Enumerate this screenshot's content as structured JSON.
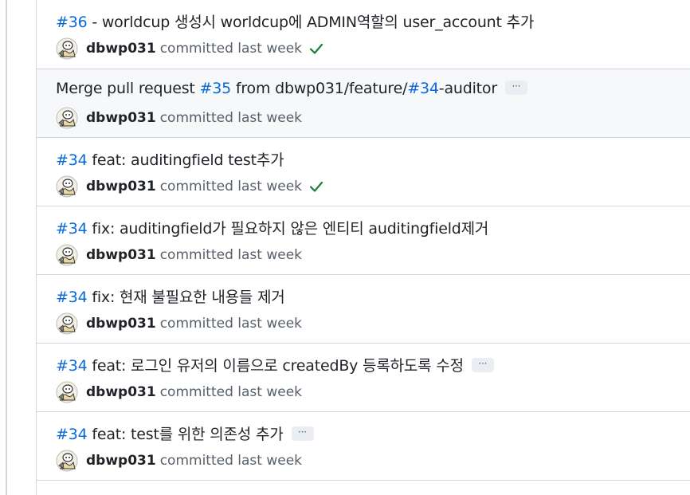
{
  "commits": [
    {
      "ref": "#36",
      "title": " - worldcup 생성시 worldcup에 ADMIN역할의 user_account 추가",
      "author": "dbwp031",
      "time": "committed last week",
      "verified": true,
      "more": false
    },
    {
      "prefix": "Merge pull request ",
      "ref": "#35",
      "middle": " from dbwp031/feature/",
      "ref2": "#34",
      "suffix": "-auditor",
      "author": "dbwp031",
      "time": "committed last week",
      "verified": false,
      "more": true
    },
    {
      "ref": "#34",
      "title": " feat: auditingfield test추가",
      "author": "dbwp031",
      "time": "committed last week",
      "verified": true,
      "more": false
    },
    {
      "ref": "#34",
      "title": " fix: auditingfield가 필요하지 않은 엔티티 auditingfield제거",
      "author": "dbwp031",
      "time": "committed last week",
      "verified": false,
      "more": false
    },
    {
      "ref": "#34",
      "title": " fix: 현재 불필요한 내용들 제거",
      "author": "dbwp031",
      "time": "committed last week",
      "verified": false,
      "more": false
    },
    {
      "ref": "#34",
      "title": " feat: 로그인 유저의 이름으로 createdBy 등록하도록 수정",
      "author": "dbwp031",
      "time": "committed last week",
      "verified": false,
      "more": true
    },
    {
      "ref": "#34",
      "title": " feat: test를 위한 의존성 추가",
      "author": "dbwp031",
      "time": "committed last week",
      "verified": false,
      "more": true
    }
  ],
  "more_label": "···",
  "colors": {
    "link": "#0969da",
    "check": "#1a7f37",
    "muted": "#57606a"
  }
}
